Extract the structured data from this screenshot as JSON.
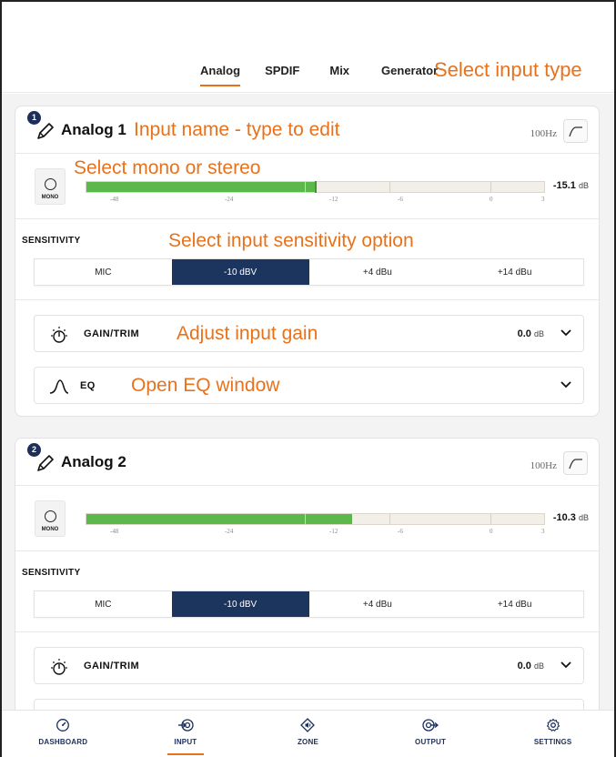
{
  "tabs": [
    "Analog",
    "SPDIF",
    "Mix",
    "Generator"
  ],
  "active_tab": 0,
  "annotations": {
    "input_type": "Select input type",
    "input_name": "Input name - type to edit",
    "mono_stereo": "Select mono or stereo",
    "sensitivity": "Select input sensitivity option",
    "gain": "Adjust input gain",
    "eq": "Open EQ window"
  },
  "meter_scale": [
    "-48",
    "-24",
    "-12",
    "-6",
    "0",
    "3"
  ],
  "inputs": [
    {
      "badge": "1",
      "name": "Analog 1",
      "hpf": "100Hz",
      "mode": "MONO",
      "level_fraction": 0.5,
      "level_db": "-15.1",
      "db_unit": "dB",
      "sensitivity_label": "SENSITIVITY",
      "sensitivity_options": [
        "MIC",
        "-10 dBV",
        "+4 dBu",
        "+14 dBu"
      ],
      "sensitivity_selected": 1,
      "gain_label": "GAIN/TRIM",
      "gain_value": "0.0",
      "gain_unit": "dB",
      "eq_label": "EQ"
    },
    {
      "badge": "2",
      "name": "Analog 2",
      "hpf": "100Hz",
      "mode": "MONO",
      "level_fraction": 0.58,
      "level_db": "-10.3",
      "db_unit": "dB",
      "sensitivity_label": "SENSITIVITY",
      "sensitivity_options": [
        "MIC",
        "-10 dBV",
        "+4 dBu",
        "+14 dBu"
      ],
      "sensitivity_selected": 1,
      "gain_label": "GAIN/TRIM",
      "gain_value": "0.0",
      "gain_unit": "dB"
    }
  ],
  "nav": {
    "items": [
      "DASHBOARD",
      "INPUT",
      "ZONE",
      "OUTPUT",
      "SETTINGS"
    ],
    "icons": [
      "dashboard-icon",
      "input-icon",
      "zone-icon",
      "output-icon",
      "settings-icon"
    ],
    "active": 1
  },
  "colors": {
    "accent": "#e8721c",
    "navy": "#1c355e",
    "meter_green": "#5cb84a"
  }
}
